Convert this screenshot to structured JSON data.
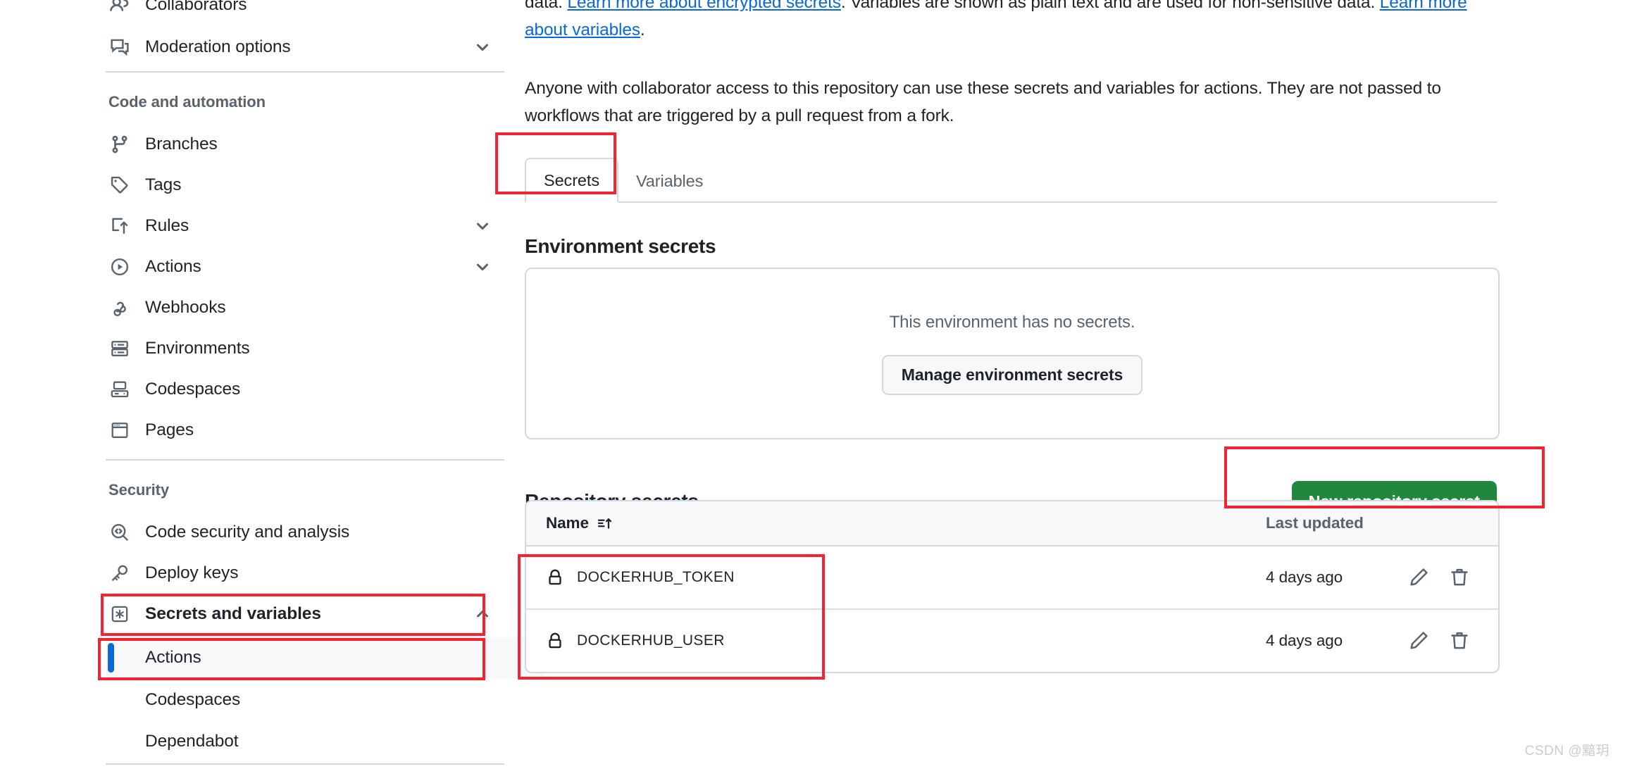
{
  "sidebar": {
    "items": [
      {
        "label": "Collaborators",
        "icon": "people-icon",
        "has_chevron": false,
        "partial": true
      },
      {
        "label": "Moderation options",
        "icon": "comment-discussion-icon",
        "has_chevron": true
      }
    ],
    "code_automation": {
      "heading": "Code and automation",
      "items": [
        {
          "label": "Branches",
          "icon": "git-branch-icon",
          "has_chevron": false
        },
        {
          "label": "Tags",
          "icon": "tag-icon",
          "has_chevron": false
        },
        {
          "label": "Rules",
          "icon": "rules-icon",
          "has_chevron": true
        },
        {
          "label": "Actions",
          "icon": "play-circle-icon",
          "has_chevron": true
        },
        {
          "label": "Webhooks",
          "icon": "webhook-icon",
          "has_chevron": false
        },
        {
          "label": "Environments",
          "icon": "server-icon",
          "has_chevron": false
        },
        {
          "label": "Codespaces",
          "icon": "codespaces-icon",
          "has_chevron": false
        },
        {
          "label": "Pages",
          "icon": "browser-icon",
          "has_chevron": false
        }
      ]
    },
    "security": {
      "heading": "Security",
      "items": [
        {
          "label": "Code security and analysis",
          "icon": "code-search-icon",
          "has_chevron": false
        },
        {
          "label": "Deploy keys",
          "icon": "key-icon",
          "has_chevron": false
        },
        {
          "label": "Secrets and variables",
          "icon": "asterisk-box-icon",
          "has_chevron": true,
          "expanded": true,
          "highlighted": true
        }
      ],
      "sub_items": [
        {
          "label": "Actions",
          "selected": true,
          "highlighted": true
        },
        {
          "label": "Codespaces",
          "selected": false
        },
        {
          "label": "Dependabot",
          "selected": false
        }
      ]
    }
  },
  "main": {
    "intro_line1_prefix": "data. ",
    "intro_link1": "Learn more about encrypted secrets",
    "intro_line1_middle": ". Variables are shown as plain text and are used for non-sensitive data. ",
    "intro_link2": "Learn more about variables",
    "intro_line1_suffix": ".",
    "intro_paragraph2": "Anyone with collaborator access to this repository can use these secrets and variables for actions. They are not passed to workflows that are triggered by a pull request from a fork.",
    "tabs": [
      {
        "label": "Secrets",
        "active": true,
        "highlighted": true
      },
      {
        "label": "Variables",
        "active": false
      }
    ],
    "environment_secrets": {
      "heading": "Environment secrets",
      "empty_message": "This environment has no secrets.",
      "manage_button": "Manage environment secrets"
    },
    "repository_secrets": {
      "heading": "Repository secrets",
      "new_button": "New repository secret",
      "columns": {
        "name": "Name",
        "name_sort_icon": "sort-asc-icon",
        "last_updated": "Last updated"
      },
      "rows": [
        {
          "icon": "lock-icon",
          "name": "DOCKERHUB_TOKEN",
          "last_updated": "4 days ago",
          "edit_icon": "pencil-icon",
          "delete_icon": "trash-icon"
        },
        {
          "icon": "lock-icon",
          "name": "DOCKERHUB_USER",
          "last_updated": "4 days ago",
          "edit_icon": "pencil-icon",
          "delete_icon": "trash-icon"
        }
      ]
    }
  },
  "watermark": "CSDN @黯玥",
  "colors": {
    "accent_blue": "#0969da",
    "success_green": "#1f883d",
    "annotation_red": "#f5232f",
    "border_grey": "#d1d9e0",
    "muted_text": "#59636e"
  }
}
